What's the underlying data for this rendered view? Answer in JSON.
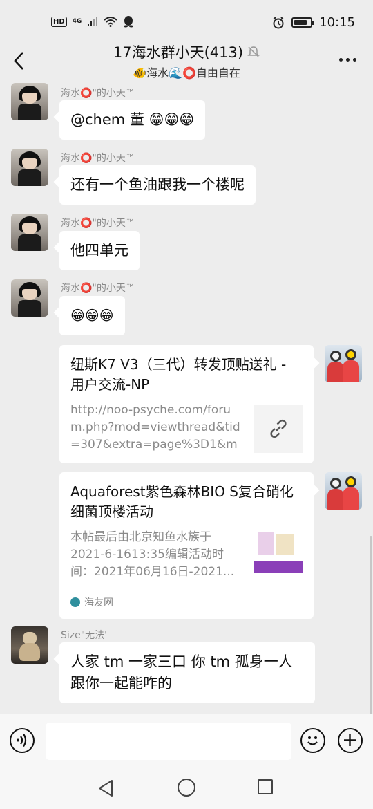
{
  "status_bar": {
    "hd": "HD",
    "network": "4G",
    "time": "10:15"
  },
  "header": {
    "title": "17海水群小天(413)",
    "subtitle": "🐠海水🌊⭕自由自在"
  },
  "messages": [
    {
      "sender": "海水⭕\"的小天™",
      "text": "@chem 董 😁😁😁"
    },
    {
      "sender": "海水⭕\"的小天™",
      "text": "还有一个鱼油跟我一个楼呢"
    },
    {
      "sender": "海水⭕\"的小天™",
      "text": "他四单元"
    },
    {
      "sender": "海水⭕\"的小天™",
      "text": "😁😁😁"
    }
  ],
  "link_card_1": {
    "title": "纽斯K7 V3（三代）转发顶贴送礼 - 用户交流-NP",
    "desc": "http://noo-psyche.com/forum.php?mod=viewthread&tid=307&extra=page%3D1&mo..."
  },
  "link_card_2": {
    "title": "Aquaforest紫色森林BIO S复合硝化细菌顶楼活动",
    "desc": "本帖最后由北京知鱼水族于2021-6-1613:35编辑活动时间：2021年06月16日-2021...",
    "source": "海友网"
  },
  "last_message": {
    "sender": "Size\"无法'",
    "text": "人家 tm 一家三口 你 tm 孤身一人跟你一起能咋的"
  },
  "icons": {
    "back": "back-arrow-icon",
    "mute": "mute-bell-icon",
    "more": "more-icon",
    "voice": "voice-icon",
    "emoji": "emoji-icon",
    "plus": "plus-icon",
    "link": "link-icon"
  }
}
